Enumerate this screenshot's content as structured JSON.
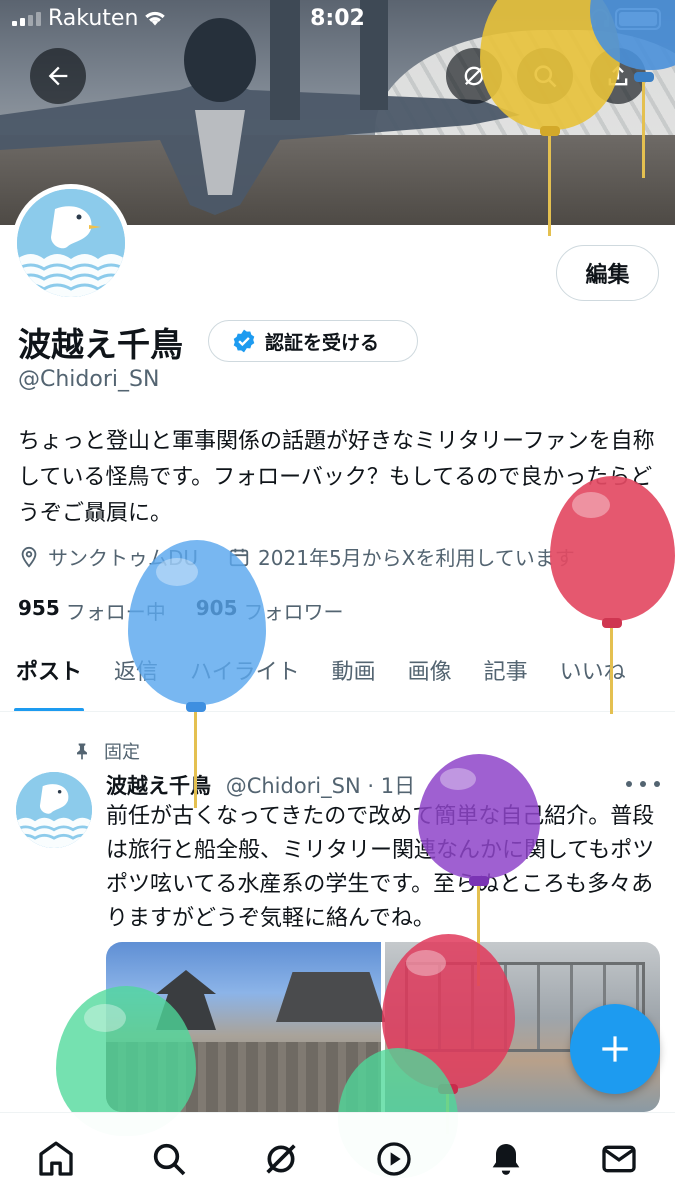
{
  "status_bar": {
    "carrier": "Rakuten",
    "time": "8:02"
  },
  "profile": {
    "display_name": "波越え千鳥",
    "verify_label": "認証を受ける",
    "handle": "@Chidori_SN",
    "edit_label": "編集",
    "bio": "ちょっと登山と軍事関係の話題が好きなミリタリーファンを自称している怪鳥です。フォローバック？もしてるので良かったらどうぞご贔屓に。",
    "location": "サンクトゥムDU",
    "joined": "2021年5月からXを利用しています",
    "following_count": "955",
    "following_label": "フォロー中",
    "followers_count": "905",
    "followers_label": "フォロワー"
  },
  "tabs": [
    "ポスト",
    "返信",
    "ハイライト",
    "動画",
    "画像",
    "記事",
    "いいね"
  ],
  "pinned_post": {
    "pinned_label": "固定",
    "author": "波越え千鳥",
    "handle_time": "@Chidori_SN · 1日",
    "text": "前任が古くなってきたので改めて簡単な自己紹介。普段は旅行と船全般、ミリタリー関連なんかに関してもポツポツ呟いてる水産系の学生です。至らぬところも多々ありますがどうぞ気軽に絡んでね。"
  },
  "colors": {
    "accent": "#1d9bf0",
    "text_primary": "#0f1419",
    "text_secondary": "#536471"
  },
  "icons": {
    "header": [
      "back-arrow-icon",
      "grok-icon",
      "search-icon",
      "share-icon"
    ],
    "bottom_nav": [
      "home-icon",
      "search-icon",
      "grok-icon",
      "video-icon",
      "notifications-icon",
      "messages-icon"
    ]
  }
}
